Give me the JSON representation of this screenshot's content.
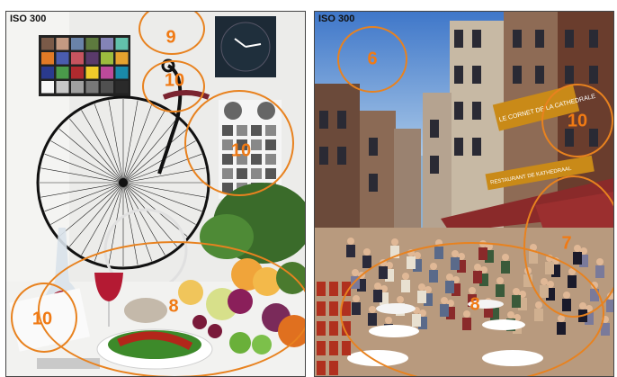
{
  "left_panel": {
    "iso_label": "ISO 300",
    "scores": [
      "9",
      "10",
      "10",
      "8",
      "10"
    ]
  },
  "right_panel": {
    "iso_label": "ISO 300",
    "scores": [
      "6",
      "10",
      "7",
      "8"
    ],
    "signs": [
      "LE CORNET DE LA CATHEDRALE",
      "RESTAURANT DE KATHEDRAAL"
    ]
  },
  "colors": {
    "ring": "#e8821f",
    "score": "#f07a14"
  }
}
